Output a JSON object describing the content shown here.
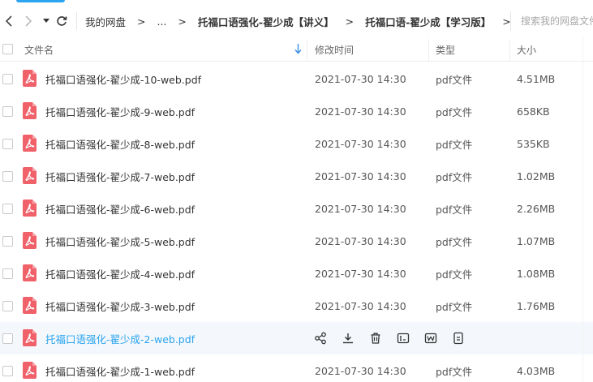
{
  "nav": {
    "back_icon": "back-arrow-icon",
    "forward_icon": "forward-arrow-icon",
    "history_dropdown_icon": "dropdown-caret-icon",
    "refresh_icon": "refresh-icon"
  },
  "breadcrumb": {
    "root": "我的网盘",
    "separator": ">",
    "ellipsis": "...",
    "items": [
      "托福口语强化-翟少成【讲义】",
      "托福口语-翟少成【学习版】"
    ]
  },
  "search": {
    "placeholder": "搜索我的网盘文件"
  },
  "header": {
    "name": "文件名",
    "modified": "修改时间",
    "type": "类型",
    "size": "大小",
    "sort_icon": "sort-down-arrow-icon"
  },
  "colors": {
    "accent": "#2aa3f0",
    "pdf_red": "#f0616a",
    "hover_bg": "#f4f8fc"
  },
  "files": [
    {
      "name": "托福口语强化-翟少成-10-web.pdf",
      "modified": "2021-07-30 14:30",
      "type": "pdf文件",
      "size": "4.51MB"
    },
    {
      "name": "托福口语强化-翟少成-9-web.pdf",
      "modified": "2021-07-30 14:30",
      "type": "pdf文件",
      "size": "658KB"
    },
    {
      "name": "托福口语强化-翟少成-8-web.pdf",
      "modified": "2021-07-30 14:30",
      "type": "pdf文件",
      "size": "535KB"
    },
    {
      "name": "托福口语强化-翟少成-7-web.pdf",
      "modified": "2021-07-30 14:30",
      "type": "pdf文件",
      "size": "1.02MB"
    },
    {
      "name": "托福口语强化-翟少成-6-web.pdf",
      "modified": "2021-07-30 14:30",
      "type": "pdf文件",
      "size": "2.26MB"
    },
    {
      "name": "托福口语强化-翟少成-5-web.pdf",
      "modified": "2021-07-30 14:30",
      "type": "pdf文件",
      "size": "1.07MB"
    },
    {
      "name": "托福口语强化-翟少成-4-web.pdf",
      "modified": "2021-07-30 14:30",
      "type": "pdf文件",
      "size": "1.08MB"
    },
    {
      "name": "托福口语强化-翟少成-3-web.pdf",
      "modified": "2021-07-30 14:30",
      "type": "pdf文件",
      "size": "1.76MB"
    },
    {
      "name": "托福口语强化-翟少成-2-web.pdf",
      "hovered": true,
      "actions": [
        "share-icon",
        "download-icon",
        "delete-icon",
        "text-convert-icon",
        "word-convert-icon",
        "more-icon"
      ]
    },
    {
      "name": "托福口语强化-翟少成-1-web.pdf",
      "modified": "2021-07-30 14:30",
      "type": "pdf文件",
      "size": "4.03MB"
    }
  ]
}
